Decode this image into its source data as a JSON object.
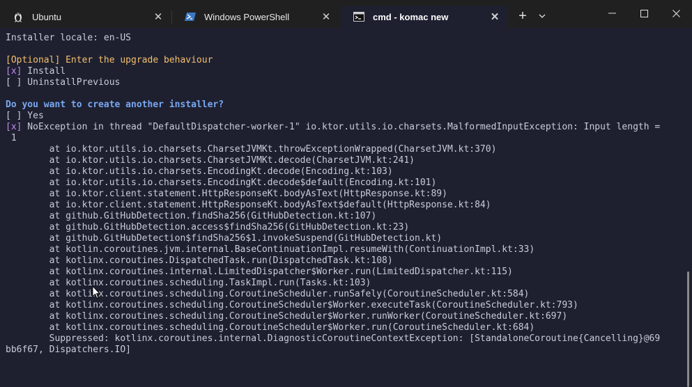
{
  "tabs": [
    {
      "label": "Ubuntu",
      "icon": "linux-penguin-icon",
      "active": false
    },
    {
      "label": "Windows PowerShell",
      "icon": "powershell-icon",
      "active": false
    },
    {
      "label": "cmd - komac  new",
      "icon": "cmd-icon",
      "active": true
    }
  ],
  "tabbar": {
    "new_tab": "+",
    "close_glyph": "✕"
  },
  "colors": {
    "background": "#1e2030",
    "tabbar": "#202020",
    "yellow": "#f5c06a",
    "blue": "#7aa7f0",
    "purple": "#c08ae8",
    "text": "#c8ccd8"
  },
  "terminal": {
    "locale": "Installer locale: en-US",
    "upgrade_prompt": "[Optional] Enter the upgrade behaviour",
    "opt_install_mark": "[x]",
    "opt_install_label": " Install",
    "opt_uninstall": "[ ] UninstallPrevious",
    "another_prompt": "Do you want to create another installer?",
    "opt_yes": "[ ] Yes",
    "opt_no_mark": "[x]",
    "error_line": " NoException in thread \"DefaultDispatcher-worker-1\" io.ktor.utils.io.charsets.MalformedInputException: Input length =",
    "error_cont": " 1",
    "stack": [
      "        at io.ktor.utils.io.charsets.CharsetJVMKt.throwExceptionWrapped(CharsetJVM.kt:370)",
      "        at io.ktor.utils.io.charsets.CharsetJVMKt.decode(CharsetJVM.kt:241)",
      "        at io.ktor.utils.io.charsets.EncodingKt.decode(Encoding.kt:103)",
      "        at io.ktor.utils.io.charsets.EncodingKt.decode$default(Encoding.kt:101)",
      "        at io.ktor.client.statement.HttpResponseKt.bodyAsText(HttpResponse.kt:89)",
      "        at io.ktor.client.statement.HttpResponseKt.bodyAsText$default(HttpResponse.kt:84)",
      "        at github.GitHubDetection.findSha256(GitHubDetection.kt:107)",
      "        at github.GitHubDetection.access$findSha256(GitHubDetection.kt:23)",
      "        at github.GitHubDetection$findSha256$1.invokeSuspend(GitHubDetection.kt)",
      "        at kotlin.coroutines.jvm.internal.BaseContinuationImpl.resumeWith(ContinuationImpl.kt:33)",
      "        at kotlinx.coroutines.DispatchedTask.run(DispatchedTask.kt:108)",
      "        at kotlinx.coroutines.internal.LimitedDispatcher$Worker.run(LimitedDispatcher.kt:115)",
      "        at kotlinx.coroutines.scheduling.TaskImpl.run(Tasks.kt:103)",
      "        at kotlinx.coroutines.scheduling.CoroutineScheduler.runSafely(CoroutineScheduler.kt:584)",
      "        at kotlinx.coroutines.scheduling.CoroutineScheduler$Worker.executeTask(CoroutineScheduler.kt:793)",
      "        at kotlinx.coroutines.scheduling.CoroutineScheduler$Worker.runWorker(CoroutineScheduler.kt:697)",
      "        at kotlinx.coroutines.scheduling.CoroutineScheduler$Worker.run(CoroutineScheduler.kt:684)",
      "        Suppressed: kotlinx.coroutines.internal.DiagnosticCoroutineContextException: [StandaloneCoroutine{Cancelling}@69",
      "bb6f67, Dispatchers.IO]"
    ]
  }
}
